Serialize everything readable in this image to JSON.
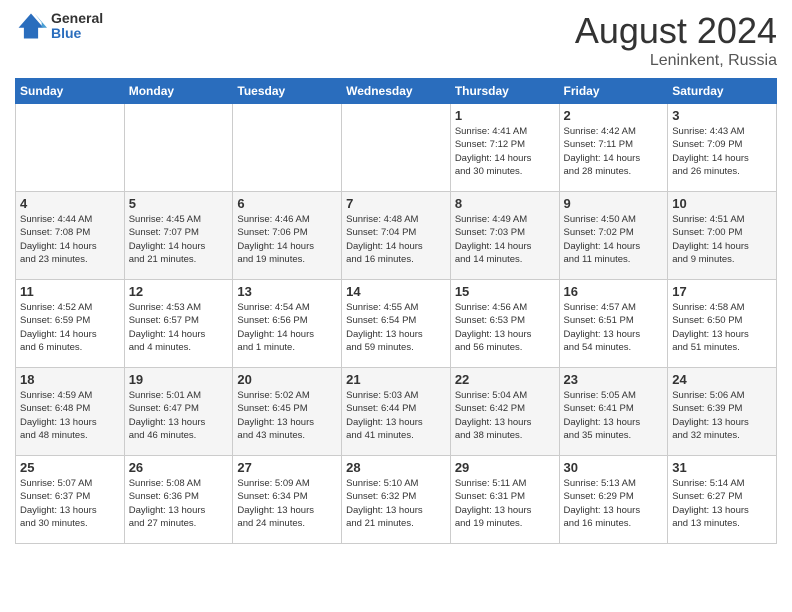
{
  "header": {
    "logo_general": "General",
    "logo_blue": "Blue",
    "title": "August 2024",
    "location": "Leninkent, Russia"
  },
  "weekdays": [
    "Sunday",
    "Monday",
    "Tuesday",
    "Wednesday",
    "Thursday",
    "Friday",
    "Saturday"
  ],
  "weeks": [
    [
      {
        "day": "",
        "info": ""
      },
      {
        "day": "",
        "info": ""
      },
      {
        "day": "",
        "info": ""
      },
      {
        "day": "",
        "info": ""
      },
      {
        "day": "1",
        "info": "Sunrise: 4:41 AM\nSunset: 7:12 PM\nDaylight: 14 hours\nand 30 minutes."
      },
      {
        "day": "2",
        "info": "Sunrise: 4:42 AM\nSunset: 7:11 PM\nDaylight: 14 hours\nand 28 minutes."
      },
      {
        "day": "3",
        "info": "Sunrise: 4:43 AM\nSunset: 7:09 PM\nDaylight: 14 hours\nand 26 minutes."
      }
    ],
    [
      {
        "day": "4",
        "info": "Sunrise: 4:44 AM\nSunset: 7:08 PM\nDaylight: 14 hours\nand 23 minutes."
      },
      {
        "day": "5",
        "info": "Sunrise: 4:45 AM\nSunset: 7:07 PM\nDaylight: 14 hours\nand 21 minutes."
      },
      {
        "day": "6",
        "info": "Sunrise: 4:46 AM\nSunset: 7:06 PM\nDaylight: 14 hours\nand 19 minutes."
      },
      {
        "day": "7",
        "info": "Sunrise: 4:48 AM\nSunset: 7:04 PM\nDaylight: 14 hours\nand 16 minutes."
      },
      {
        "day": "8",
        "info": "Sunrise: 4:49 AM\nSunset: 7:03 PM\nDaylight: 14 hours\nand 14 minutes."
      },
      {
        "day": "9",
        "info": "Sunrise: 4:50 AM\nSunset: 7:02 PM\nDaylight: 14 hours\nand 11 minutes."
      },
      {
        "day": "10",
        "info": "Sunrise: 4:51 AM\nSunset: 7:00 PM\nDaylight: 14 hours\nand 9 minutes."
      }
    ],
    [
      {
        "day": "11",
        "info": "Sunrise: 4:52 AM\nSunset: 6:59 PM\nDaylight: 14 hours\nand 6 minutes."
      },
      {
        "day": "12",
        "info": "Sunrise: 4:53 AM\nSunset: 6:57 PM\nDaylight: 14 hours\nand 4 minutes."
      },
      {
        "day": "13",
        "info": "Sunrise: 4:54 AM\nSunset: 6:56 PM\nDaylight: 14 hours\nand 1 minute."
      },
      {
        "day": "14",
        "info": "Sunrise: 4:55 AM\nSunset: 6:54 PM\nDaylight: 13 hours\nand 59 minutes."
      },
      {
        "day": "15",
        "info": "Sunrise: 4:56 AM\nSunset: 6:53 PM\nDaylight: 13 hours\nand 56 minutes."
      },
      {
        "day": "16",
        "info": "Sunrise: 4:57 AM\nSunset: 6:51 PM\nDaylight: 13 hours\nand 54 minutes."
      },
      {
        "day": "17",
        "info": "Sunrise: 4:58 AM\nSunset: 6:50 PM\nDaylight: 13 hours\nand 51 minutes."
      }
    ],
    [
      {
        "day": "18",
        "info": "Sunrise: 4:59 AM\nSunset: 6:48 PM\nDaylight: 13 hours\nand 48 minutes."
      },
      {
        "day": "19",
        "info": "Sunrise: 5:01 AM\nSunset: 6:47 PM\nDaylight: 13 hours\nand 46 minutes."
      },
      {
        "day": "20",
        "info": "Sunrise: 5:02 AM\nSunset: 6:45 PM\nDaylight: 13 hours\nand 43 minutes."
      },
      {
        "day": "21",
        "info": "Sunrise: 5:03 AM\nSunset: 6:44 PM\nDaylight: 13 hours\nand 41 minutes."
      },
      {
        "day": "22",
        "info": "Sunrise: 5:04 AM\nSunset: 6:42 PM\nDaylight: 13 hours\nand 38 minutes."
      },
      {
        "day": "23",
        "info": "Sunrise: 5:05 AM\nSunset: 6:41 PM\nDaylight: 13 hours\nand 35 minutes."
      },
      {
        "day": "24",
        "info": "Sunrise: 5:06 AM\nSunset: 6:39 PM\nDaylight: 13 hours\nand 32 minutes."
      }
    ],
    [
      {
        "day": "25",
        "info": "Sunrise: 5:07 AM\nSunset: 6:37 PM\nDaylight: 13 hours\nand 30 minutes."
      },
      {
        "day": "26",
        "info": "Sunrise: 5:08 AM\nSunset: 6:36 PM\nDaylight: 13 hours\nand 27 minutes."
      },
      {
        "day": "27",
        "info": "Sunrise: 5:09 AM\nSunset: 6:34 PM\nDaylight: 13 hours\nand 24 minutes."
      },
      {
        "day": "28",
        "info": "Sunrise: 5:10 AM\nSunset: 6:32 PM\nDaylight: 13 hours\nand 21 minutes."
      },
      {
        "day": "29",
        "info": "Sunrise: 5:11 AM\nSunset: 6:31 PM\nDaylight: 13 hours\nand 19 minutes."
      },
      {
        "day": "30",
        "info": "Sunrise: 5:13 AM\nSunset: 6:29 PM\nDaylight: 13 hours\nand 16 minutes."
      },
      {
        "day": "31",
        "info": "Sunrise: 5:14 AM\nSunset: 6:27 PM\nDaylight: 13 hours\nand 13 minutes."
      }
    ]
  ]
}
